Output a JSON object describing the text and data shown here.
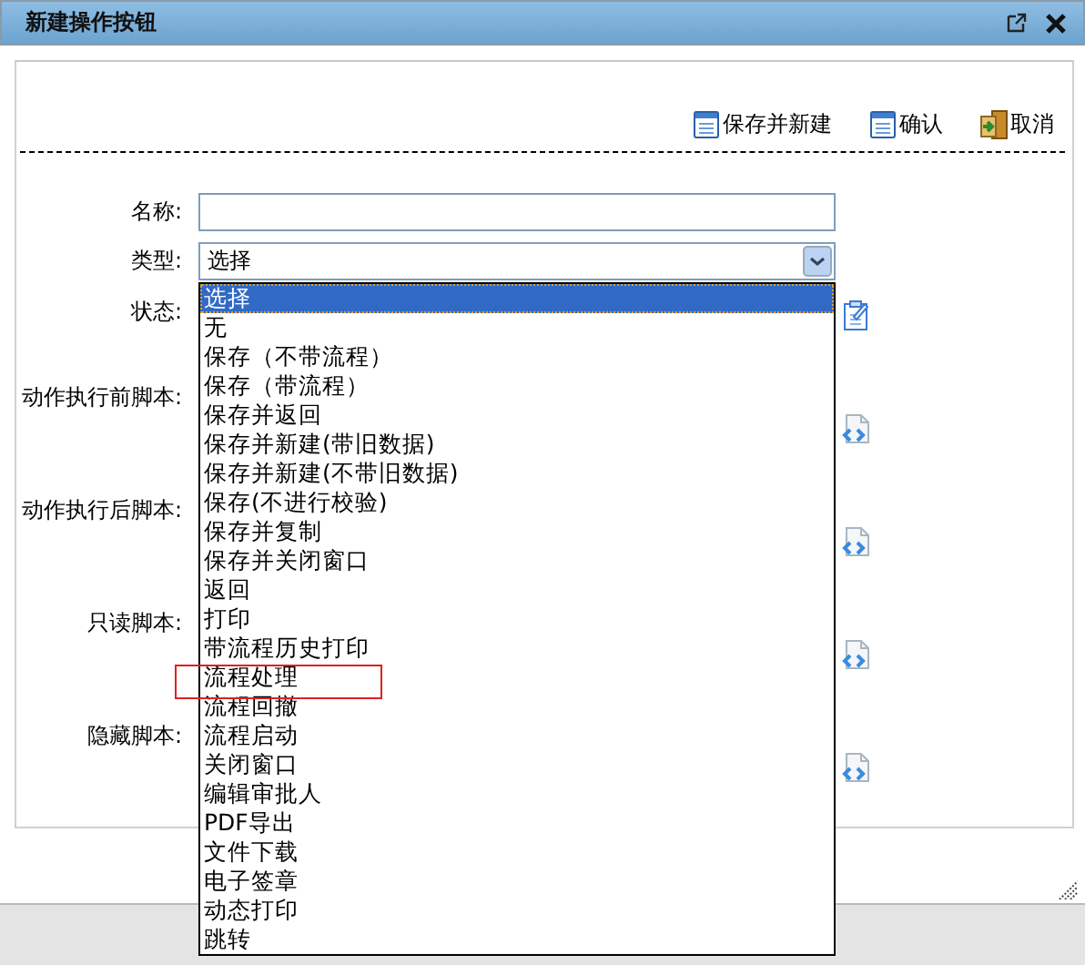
{
  "window": {
    "title": "新建操作按钮"
  },
  "toolbar": [
    {
      "label": "保存并新建",
      "kind": "save"
    },
    {
      "label": "确认",
      "kind": "save"
    },
    {
      "label": "取消",
      "kind": "exit"
    }
  ],
  "form": {
    "fields": [
      {
        "label": "名称:",
        "kind": "text"
      },
      {
        "label": "类型:",
        "kind": "select",
        "value": "选择"
      },
      {
        "label": "状态:",
        "kind": "status"
      },
      {
        "label": "动作执行前脚本:",
        "kind": "script"
      },
      {
        "label": "动作执行后脚本:",
        "kind": "script"
      },
      {
        "label": "只读脚本:",
        "kind": "script"
      },
      {
        "label": "隐藏脚本:",
        "kind": "script"
      }
    ]
  },
  "dropdown": {
    "options": [
      {
        "label": "选择",
        "selected": true,
        "marked": false
      },
      {
        "label": "无",
        "selected": false,
        "marked": false
      },
      {
        "label": "保存（不带流程）",
        "selected": false,
        "marked": false
      },
      {
        "label": "保存（带流程）",
        "selected": false,
        "marked": false
      },
      {
        "label": "保存并返回",
        "selected": false,
        "marked": false
      },
      {
        "label": "保存并新建(带旧数据)",
        "selected": false,
        "marked": false
      },
      {
        "label": "保存并新建(不带旧数据)",
        "selected": false,
        "marked": false
      },
      {
        "label": "保存(不进行校验)",
        "selected": false,
        "marked": false
      },
      {
        "label": "保存并复制",
        "selected": false,
        "marked": false
      },
      {
        "label": "保存并关闭窗口",
        "selected": false,
        "marked": false
      },
      {
        "label": "返回",
        "selected": false,
        "marked": false
      },
      {
        "label": "打印",
        "selected": false,
        "marked": false
      },
      {
        "label": "带流程历史打印",
        "selected": false,
        "marked": false
      },
      {
        "label": "流程处理",
        "selected": false,
        "marked": true
      },
      {
        "label": "流程回撤",
        "selected": false,
        "marked": false
      },
      {
        "label": "流程启动",
        "selected": false,
        "marked": false
      },
      {
        "label": "关闭窗口",
        "selected": false,
        "marked": false
      },
      {
        "label": "编辑审批人",
        "selected": false,
        "marked": false
      },
      {
        "label": "PDF导出",
        "selected": false,
        "marked": false
      },
      {
        "label": "文件下载",
        "selected": false,
        "marked": false
      },
      {
        "label": "电子签章",
        "selected": false,
        "marked": false
      },
      {
        "label": "动态打印",
        "selected": false,
        "marked": false
      },
      {
        "label": "跳转",
        "selected": false,
        "marked": false
      }
    ]
  }
}
